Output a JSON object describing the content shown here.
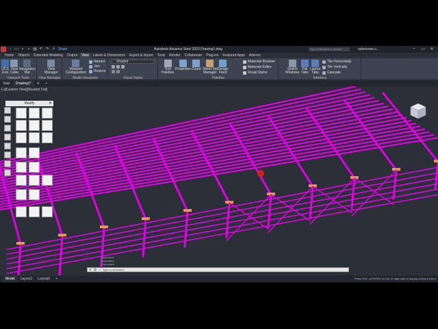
{
  "titlebar": {
    "share_label": "Share",
    "title": "Autodesk Advance Steel 2023   Drawing1.dwg",
    "search_placeholder": "Type a keyword or phrase",
    "user": "nybesmeo.c...",
    "minimize": "–",
    "maximize": "▭",
    "close": "✕"
  },
  "menu_tabs": [
    {
      "label": "Home"
    },
    {
      "label": "Objects"
    },
    {
      "label": "Extended Modeling"
    },
    {
      "label": "Output"
    },
    {
      "label": "View"
    },
    {
      "label": "Labels & Dimensions"
    },
    {
      "label": "Export & Import"
    },
    {
      "label": "Tools"
    },
    {
      "label": "Render"
    },
    {
      "label": "Collaborate"
    },
    {
      "label": "Plug-ins"
    },
    {
      "label": "Featured Apps"
    },
    {
      "label": "Add-ins"
    }
  ],
  "ribbon": {
    "viewport_tools": {
      "label": "Viewport Tools",
      "buttons": [
        {
          "label": "UCS"
        },
        {
          "label": "View"
        },
        {
          "label": "Navigation"
        }
      ],
      "sublabels": [
        "Icon",
        "Cube",
        "Bar"
      ]
    },
    "view_manager": {
      "label": "View Manager",
      "button": "View",
      "sub": "Manager"
    },
    "model_viewports": {
      "label": "Model Viewports",
      "button": "Viewport",
      "sub": "Configuration",
      "named": "Named",
      "join": "Join",
      "restore": "Restore"
    },
    "visual_styles": {
      "label": "Visual Styles",
      "current": "Shaded"
    },
    "palettes": {
      "label": "Palettes",
      "buttons": [
        {
          "label": "Tool",
          "sub": "Palettes"
        },
        {
          "label": "Properties",
          "sub": ""
        },
        {
          "label": "Count",
          "sub": ""
        },
        {
          "label": "Sheet Set",
          "sub": "Manager"
        },
        {
          "label": "Design",
          "sub": "Feed"
        }
      ],
      "materials_browser": "Materials Browser",
      "materials_editor": "Materials Editor",
      "visual_styles": "Visual Styles"
    },
    "interface": {
      "label": "Interface",
      "switch": "Switch",
      "switch_sub": "Windows",
      "file": "File",
      "file_sub": "Tabs",
      "layout": "Layout",
      "layout_sub": "Tabs",
      "tile_h": "Tile Horizontally",
      "tile_v": "Tile Vertically",
      "cascade": "Cascade"
    }
  },
  "file_tabs": [
    {
      "label": "Start"
    },
    {
      "label": "Drawing1*"
    }
  ],
  "file_tabs_close": "✕",
  "file_tabs_add": "+",
  "viewport": {
    "label": "[–][Custom View][Shaded Foil]"
  },
  "modify_palette": {
    "title": "Modify",
    "close": "✕"
  },
  "cmdline": {
    "prompt": "Type a command",
    "history": [
      "Command:",
      "Command:",
      "Command:"
    ]
  },
  "layout_tabs": [
    {
      "label": "Model"
    },
    {
      "label": "Layout1"
    },
    {
      "label": "Layout2"
    }
  ],
  "layout_add": "+",
  "status_hint": "Press ESC or ENTER to exit, or right-click to display shortcut menu.",
  "colors": {
    "structure": "#e100e6",
    "accent": "#1e90ff",
    "plate": "#e39a4a"
  }
}
